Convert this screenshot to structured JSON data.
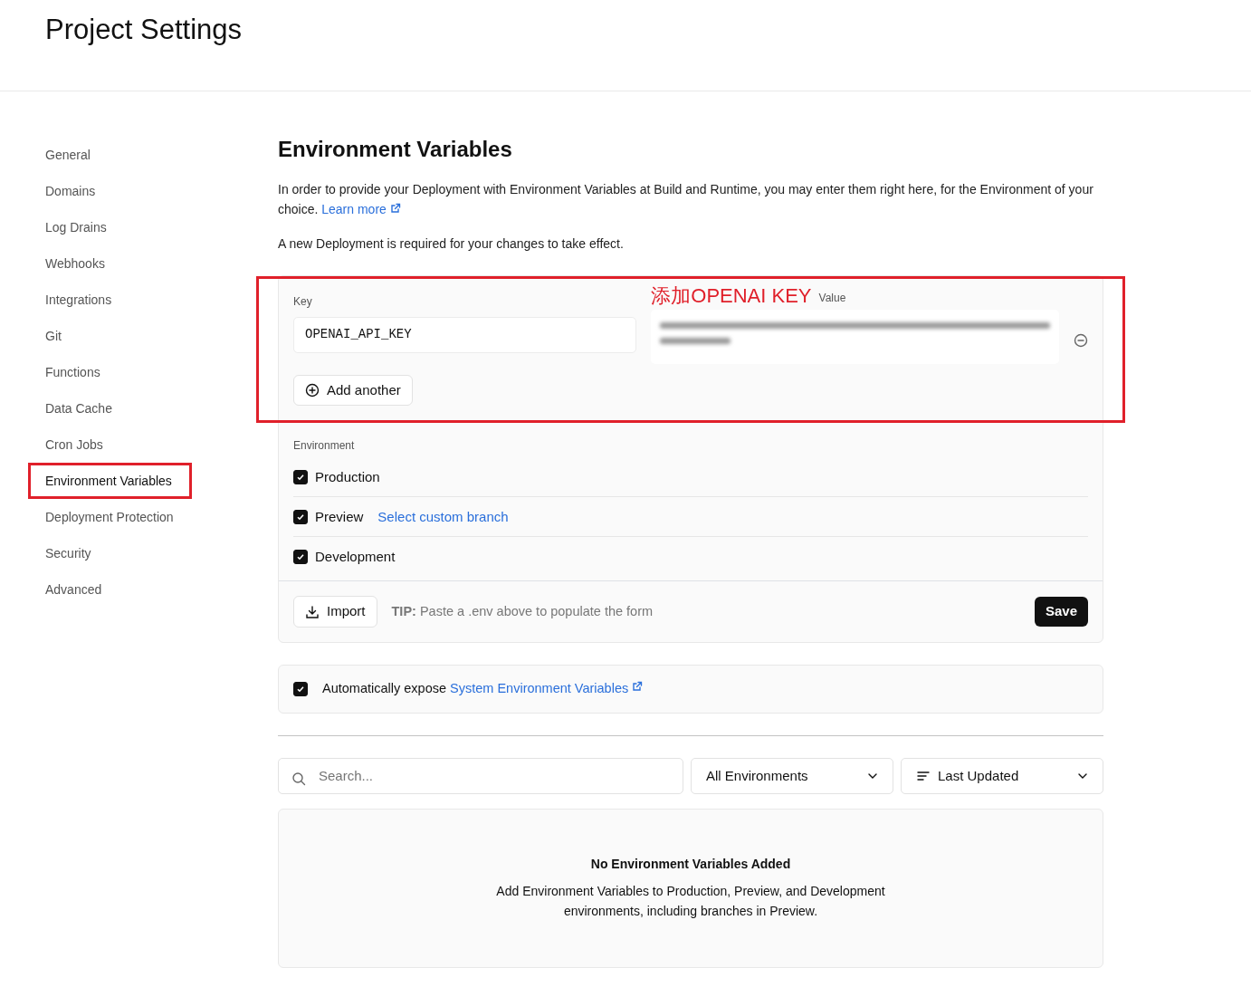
{
  "header": {
    "title": "Project Settings"
  },
  "sidebar": {
    "items": [
      {
        "label": "General",
        "selected": false,
        "highlighted": false
      },
      {
        "label": "Domains",
        "selected": false,
        "highlighted": false
      },
      {
        "label": "Log Drains",
        "selected": false,
        "highlighted": false
      },
      {
        "label": "Webhooks",
        "selected": false,
        "highlighted": false
      },
      {
        "label": "Integrations",
        "selected": false,
        "highlighted": false
      },
      {
        "label": "Git",
        "selected": false,
        "highlighted": false
      },
      {
        "label": "Functions",
        "selected": false,
        "highlighted": false
      },
      {
        "label": "Data Cache",
        "selected": false,
        "highlighted": false
      },
      {
        "label": "Cron Jobs",
        "selected": false,
        "highlighted": false
      },
      {
        "label": "Environment Variables",
        "selected": true,
        "highlighted": true
      },
      {
        "label": "Deployment Protection",
        "selected": false,
        "highlighted": false
      },
      {
        "label": "Security",
        "selected": false,
        "highlighted": false
      },
      {
        "label": "Advanced",
        "selected": false,
        "highlighted": false
      }
    ]
  },
  "main": {
    "title": "Environment Variables",
    "description": "In order to provide your Deployment with Environment Variables at Build and Runtime, you may enter them right here, for the Environment of your choice.",
    "learn_more": "Learn more",
    "notice": "A new Deployment is required for your changes to take effect.",
    "form": {
      "highlighted": true,
      "annotation": "添加OPENAI KEY",
      "key_label": "Key",
      "value_label": "Value",
      "key_value": "OPENAI_API_KEY",
      "add_another": "Add another",
      "environment_label": "Environment",
      "environments": [
        {
          "label": "Production",
          "checked": true
        },
        {
          "label": "Preview",
          "checked": true,
          "link": "Select custom branch"
        },
        {
          "label": "Development",
          "checked": true
        }
      ],
      "import": "Import",
      "tip": "**TIP:** Paste a .env above to populate the form",
      "save": "Save"
    },
    "auto_expose": {
      "checked": true,
      "label": "Automatically expose",
      "link": "System Environment Variables"
    },
    "filters": {
      "search_placeholder": "Search...",
      "environment_select": "All Environments",
      "sort_select": "Last Updated"
    },
    "empty_state": {
      "title": "No Environment Variables Added",
      "text": "Add Environment Variables to Production, Preview, and Development environments, including branches in Preview."
    }
  }
}
